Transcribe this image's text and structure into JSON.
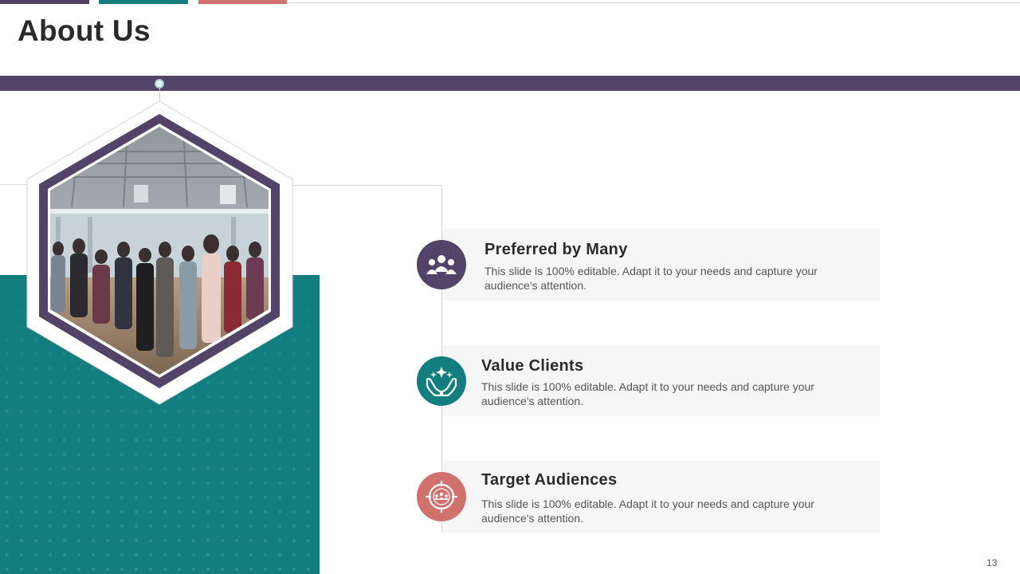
{
  "slide": {
    "title": "About Us",
    "page_number": "13"
  },
  "colors": {
    "purple": "#524468",
    "teal": "#127e7f",
    "coral": "#d0716d",
    "card_bg": "#f6f6f6"
  },
  "photo": {
    "description_icon": "team-photo"
  },
  "items": [
    {
      "title": "Preferred by Many",
      "description": "This slide is 100% editable. Adapt it to your needs and capture your audience's attention.",
      "icon": "people-group-icon",
      "color": "#524468"
    },
    {
      "title": "Value Clients",
      "description": "This slide is 100% editable. Adapt it to your needs and capture your audience's attention.",
      "icon": "hands-sparkle-icon",
      "color": "#127e7f"
    },
    {
      "title": "Target Audiences",
      "description": "This slide is 100% editable. Adapt it to your needs and capture your audience's attention.",
      "icon": "target-audience-icon",
      "color": "#d0716d"
    }
  ]
}
